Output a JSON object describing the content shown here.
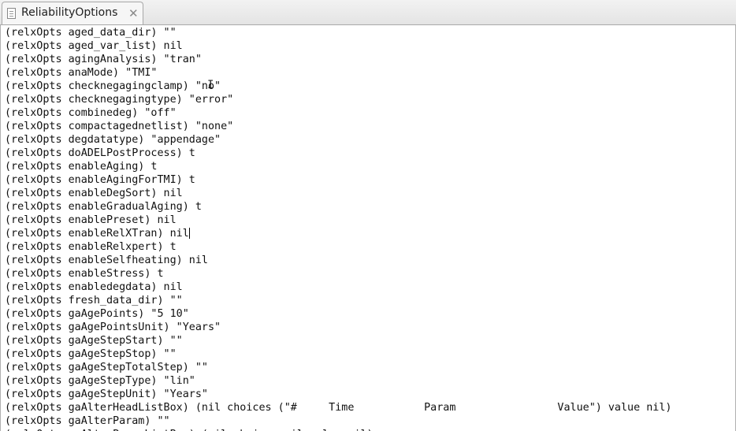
{
  "tab": {
    "title": "ReliabilityOptions",
    "icon": "document-icon",
    "close_icon": "close-icon"
  },
  "lines": [
    "(relxOpts aged_data_dir) \"\"",
    "(relxOpts aged_var_list) nil",
    "(relxOpts agingAnalysis) \"tran\"",
    "(relxOpts anaMode) \"TMI\"",
    "(relxOpts checknegagingclamp) \"no\"",
    "(relxOpts checknegagingtype) \"error\"",
    "(relxOpts combinedeg) \"off\"",
    "(relxOpts compactagednetlist) \"none\"",
    "(relxOpts degdatatype) \"appendage\"",
    "(relxOpts doADELPostProcess) t",
    "(relxOpts enableAging) t",
    "(relxOpts enableAgingForTMI) t",
    "(relxOpts enableDegSort) nil",
    "(relxOpts enableGradualAging) t",
    "(relxOpts enablePreset) nil",
    "(relxOpts enableRelXTran) nil",
    "(relxOpts enableRelxpert) t",
    "(relxOpts enableSelfheating) nil",
    "(relxOpts enableStress) t",
    "(relxOpts enabledegdata) nil",
    "(relxOpts fresh_data_dir) \"\"",
    "(relxOpts gaAgePoints) \"5 10\"",
    "(relxOpts gaAgePointsUnit) \"Years\"",
    "(relxOpts gaAgeStepStart) \"\"",
    "(relxOpts gaAgeStepStop) \"\"",
    "(relxOpts gaAgeStepTotalStep) \"\"",
    "(relxOpts gaAgeStepType) \"lin\"",
    "(relxOpts gaAgeStepUnit) \"Years\"",
    "(relxOpts gaAlterHeadListBox) (nil choices (\"#     Time           Param                Value\") value nil)",
    "(relxOpts gaAlterParam) \"\"",
    "(relxOpts gaAlterParamListBox) (nil choices nil value nil)"
  ]
}
